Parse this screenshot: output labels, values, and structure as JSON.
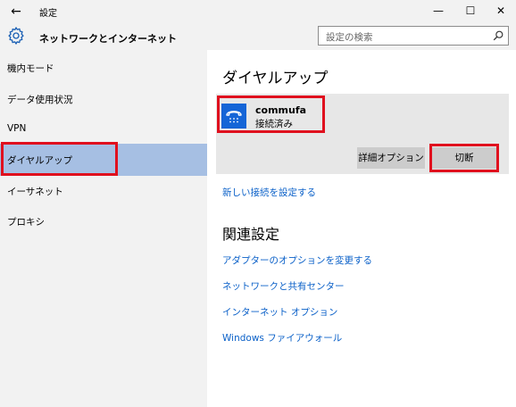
{
  "window": {
    "title": "設定",
    "back_label": "←",
    "minimize_label": "—",
    "maximize_label": "☐",
    "close_label": "✕"
  },
  "header": {
    "title": "ネットワークとインターネット",
    "search_placeholder": "設定の検索"
  },
  "sidebar": {
    "items": [
      {
        "label": "機内モード"
      },
      {
        "label": "データ使用状況"
      },
      {
        "label": "VPN"
      },
      {
        "label": "ダイヤルアップ",
        "selected": true
      },
      {
        "label": "イーサネット"
      },
      {
        "label": "プロキシ"
      }
    ]
  },
  "main": {
    "heading": "ダイヤルアップ",
    "connection": {
      "name": "commufa",
      "status": "接続済み",
      "icon": "dialup-phone-icon"
    },
    "buttons": {
      "advanced": "詳細オプション",
      "disconnect": "切断"
    },
    "new_connection_link": "新しい接続を設定する",
    "related_heading": "関連設定",
    "related_links": [
      "アダプターのオプションを変更する",
      "ネットワークと共有センター",
      "インターネット オプション",
      "Windows ファイアウォール"
    ]
  },
  "colors": {
    "accent": "#1565d7",
    "link": "#0a60c8",
    "selected_item": "#a6bfe3",
    "highlight_box": "#e0101e",
    "panel": "#e7e7e7"
  }
}
